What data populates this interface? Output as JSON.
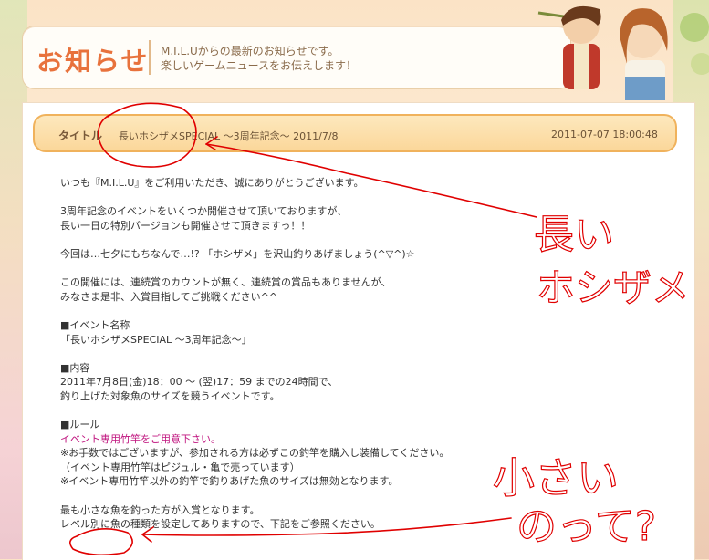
{
  "header": {
    "title": "お知らせ",
    "subtitle_line1": "M.I.L.Uからの最新のお知らせです。",
    "subtitle_line2": "楽しいゲームニュースをお伝えします！"
  },
  "notice": {
    "title_label": "タイトル",
    "title": "長いホシザメSPECIAL ～3周年記念～ 2011/7/8",
    "posted_at": "2011-07-07 18:00:48"
  },
  "body": [
    "いつも『M.I.L.U』をご利用いただき、誠にありがとうございます。",
    "",
    "3周年記念のイベントをいくつか開催させて頂いておりますが、",
    "長い一日の特別バージョンも開催させて頂きますっ！！",
    "",
    "今回は…七夕にもちなんで…!? 「ホシザメ」を沢山釣りあげましょう(^▽^)☆",
    "",
    "この開催には、連続賞のカウントが無く、連続賞の賞品もありませんが、",
    "みなさま是非、入賞目指してご挑戦ください^^",
    "",
    "■イベント名称",
    "「長いホシザメSPECIAL ～3周年記念～」",
    "",
    "■内容",
    "2011年7月8日(金)18：00 ～ (翌)17：59 までの24時間で、",
    "釣り上げた対象魚のサイズを競うイベントです。",
    "",
    "■ルール",
    "イベント専用竹竿をご用意下さい。",
    "※お手数ではございますが、参加される方は必ずこの釣竿を購入し装備してください。",
    "（イベント専用竹竿はピジュル・亀で売っています）",
    "※イベント専用竹竿以外の釣竿で釣りあげた魚のサイズは無効となります。",
    "",
    "最も小さな魚を釣った方が入賞となります。",
    "レベル別に魚の種類を設定してありますので、下記をご参照ください。"
  ],
  "annotations": {
    "note1_line1": "長い",
    "note1_line2": "ホシザメ",
    "note2_line1": "小さい",
    "note2_line2": "のって?"
  },
  "colors": {
    "accent": "#e8723c",
    "title_bar_border": "#f0b25c",
    "highlight_text": "#c0157f",
    "annotation_ink": "#e00000"
  }
}
